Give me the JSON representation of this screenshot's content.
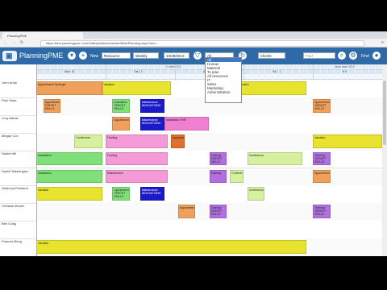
{
  "browser": {
    "tab_title": "PlanningPME",
    "url": "https://test.planningpme.com/Gallery/webaccess/en/Web/Planning.aspx?uid=...",
    "nav": {
      "back": "←",
      "forward": "→",
      "reload": "↻"
    }
  },
  "app": {
    "brand": "PlanningPME",
    "new_label": "New",
    "resource_select": "Resource",
    "view_select": "Weekly",
    "date_select": "10/28/2013",
    "filter_select": "All",
    "clients_select": "Clients",
    "find_placeholder": "Find",
    "find_label": "Find",
    "filter_options": [
      "All",
      "Human",
      "Material",
      "To plan",
      "All resources",
      "IT",
      "Sales",
      "Marketing",
      "Administration"
    ],
    "colors": {
      "toolbar": "#2f6aa8",
      "accent": "#3b78c4"
    }
  },
  "planning": {
    "month_header": "October 2013",
    "month_header_2": "November 2013",
    "days": [
      "Mon 28",
      "Tue 29",
      "Wed 30",
      "Thu 31",
      "Fri 01"
    ],
    "people": [
      "John Arhip",
      "Paul Stark",
      "Lucy Adrian",
      "Megan Cox",
      "Daniel Hill",
      "Daniel Washington",
      "Deakuna Rowland",
      "Christian Brown",
      "Ben Craig",
      "Frances Bring"
    ],
    "events": [
      {
        "label": "Appointment Synergie",
        "row": 0,
        "start": 0.0,
        "end": 0.19,
        "color": "#f0a05a"
      },
      {
        "label": "Vacation",
        "row": 0,
        "start": 0.19,
        "end": 0.39,
        "color": "#e7e32e"
      },
      {
        "label": "Vacation",
        "row": 0,
        "start": 0.58,
        "end": 0.78,
        "color": "#e7e32e"
      },
      {
        "label": "Appointment TARGET SKILLS",
        "row": 1,
        "start": 0.02,
        "end": 0.07,
        "color": "#f0a05a"
      },
      {
        "label": "Installation TARGET SKILLS",
        "row": 1,
        "start": 0.22,
        "end": 0.27,
        "color": "#7fe07a"
      },
      {
        "label": "Maintenance INNOVATIONS",
        "row": 1,
        "start": 0.3,
        "end": 0.37,
        "color": "#1a1ac8",
        "dark": true
      },
      {
        "label": "Appointment TARGET SKILLS",
        "row": 1,
        "start": 0.8,
        "end": 0.85,
        "color": "#f0a05a"
      },
      {
        "label": "Appointment",
        "row": 2,
        "start": 0.22,
        "end": 0.27,
        "color": "#f0a05a"
      },
      {
        "label": "Maintenance INNOVATIONS",
        "row": 2,
        "start": 0.3,
        "end": 0.37,
        "color": "#1a1ac8",
        "dark": true
      },
      {
        "label": "Installation PME",
        "row": 2,
        "start": 0.37,
        "end": 0.5,
        "color": "#f07fd0"
      },
      {
        "label": "Conference",
        "row": 3,
        "start": 0.11,
        "end": 0.19,
        "color": "#d6f0a0"
      },
      {
        "label": "Training",
        "row": 3,
        "start": 0.2,
        "end": 0.38,
        "color": "#f49ad6"
      },
      {
        "label": "Appointment",
        "row": 3,
        "start": 0.39,
        "end": 0.43,
        "color": "#e07030"
      },
      {
        "label": "Vacation",
        "row": 3,
        "start": 0.8,
        "end": 1.0,
        "color": "#e7e32e"
      },
      {
        "label": "Installation",
        "row": 4,
        "start": 0.0,
        "end": 0.19,
        "color": "#7fe07a"
      },
      {
        "label": "Training",
        "row": 4,
        "start": 0.2,
        "end": 0.38,
        "color": "#f49ad6"
      },
      {
        "label": "Training TARGET SKILLS",
        "row": 4,
        "start": 0.5,
        "end": 0.55,
        "color": "#b070e0"
      },
      {
        "label": "Conference",
        "row": 4,
        "start": 0.61,
        "end": 0.77,
        "color": "#d6f0a0"
      },
      {
        "label": "Training TARGET SKILLS",
        "row": 4,
        "start": 0.8,
        "end": 0.85,
        "color": "#b070e0"
      },
      {
        "label": "Installation",
        "row": 5,
        "start": 0.0,
        "end": 0.19,
        "color": "#7fe07a"
      },
      {
        "label": "Maintenance",
        "row": 5,
        "start": 0.2,
        "end": 0.38,
        "color": "#f49ad6"
      },
      {
        "label": "Training",
        "row": 5,
        "start": 0.5,
        "end": 0.55,
        "color": "#b070e0"
      },
      {
        "label": "Conference",
        "row": 5,
        "start": 0.56,
        "end": 0.6,
        "color": "#d6f0a0"
      },
      {
        "label": "Appointment",
        "row": 5,
        "start": 0.8,
        "end": 0.85,
        "color": "#f0a05a"
      },
      {
        "label": "Vacation",
        "row": 6,
        "start": 0.0,
        "end": 0.19,
        "color": "#e7e32e"
      },
      {
        "label": "Appointment TARGET SKILLS",
        "row": 6,
        "start": 0.22,
        "end": 0.27,
        "color": "#7fe07a"
      },
      {
        "label": "Maintenance INNOVATIONS",
        "row": 6,
        "start": 0.3,
        "end": 0.37,
        "color": "#1a1ac8",
        "dark": true
      },
      {
        "label": "Conference",
        "row": 6,
        "start": 0.61,
        "end": 0.66,
        "color": "#d6f0a0"
      },
      {
        "label": "Appointment",
        "row": 7,
        "start": 0.41,
        "end": 0.46,
        "color": "#f0a05a"
      },
      {
        "label": "Training TARGET SKILLS",
        "row": 7,
        "start": 0.5,
        "end": 0.55,
        "color": "#b070e0"
      },
      {
        "label": "Training TARGET SKILLS",
        "row": 7,
        "start": 0.8,
        "end": 0.85,
        "color": "#b070e0"
      },
      {
        "label": "Vacation",
        "row": 9,
        "start": 0.0,
        "end": 0.78,
        "color": "#e7e32e"
      }
    ]
  }
}
